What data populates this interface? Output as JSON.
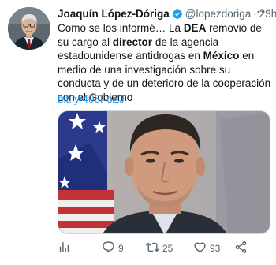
{
  "tweet": {
    "author_name": "Joaquín López-Dóriga",
    "handle": "@lopezdoriga",
    "separator": "·",
    "time": "23h",
    "text_parts": {
      "p1": "Como se los informé… La ",
      "b1": "DEA",
      "p2": " removió de su cargo al ",
      "b2": "director",
      "p3": " de la agencia estadounidense antidrogas en ",
      "b3": "México",
      "p4": " en medio de una investigación sobre su conducta y de un deterioro de la cooperación con el Gobierno"
    },
    "link": "bit.ly/408FoZJ",
    "actions": {
      "replies": "9",
      "retweets": "25",
      "likes": "93"
    }
  },
  "colors": {
    "link": "#1d9bf0",
    "verified": "#1d9bf0",
    "muted": "#536471"
  },
  "icons": {
    "verified": "verified-badge-icon",
    "more": "more-icon",
    "views": "views-icon",
    "reply": "reply-icon",
    "retweet": "retweet-icon",
    "like": "like-icon",
    "share": "share-icon"
  }
}
